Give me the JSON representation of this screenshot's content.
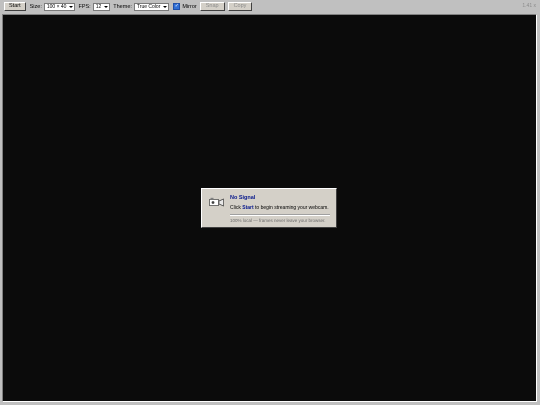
{
  "toolbar": {
    "start_label": "Start",
    "size_label": "Size:",
    "size_value": "100 × 40",
    "fps_label": "FPS:",
    "fps_value": "12",
    "theme_label": "Theme:",
    "theme_value": "True Color",
    "mirror_label": "Mirror",
    "mirror_checked": true,
    "snap_label": "Snap",
    "copy_label": "Copy",
    "version": "1.41 x"
  },
  "dialog": {
    "title": "No Signal",
    "message_before": "Click ",
    "message_bold": "Start",
    "message_after": " to begin streaming your webcam.",
    "note": "100% local — frames never leave your browser.",
    "icon": "camera-icon"
  },
  "colors": {
    "chrome": "#c0c0c0",
    "viewport": "#0b0b0b",
    "title": "#0a1a8c",
    "checkbox": "#2f6fd6"
  }
}
